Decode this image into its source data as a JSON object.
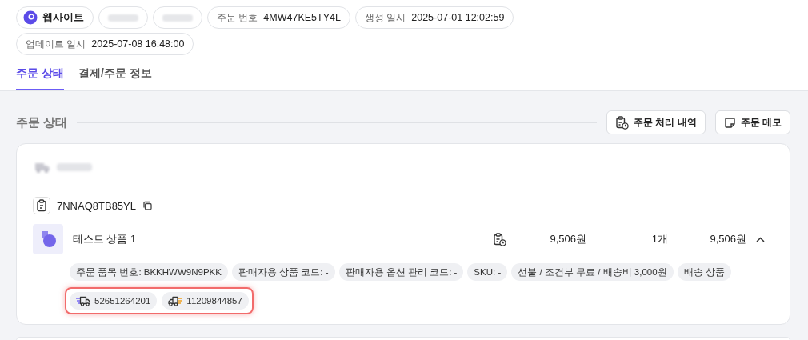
{
  "header_chips": [
    {
      "kind": "source",
      "label": "웹사이트"
    },
    {
      "kind": "redacted"
    },
    {
      "kind": "redacted"
    },
    {
      "kind": "field",
      "label": "주문 번호",
      "value": "4MW47KE5TY4L"
    },
    {
      "kind": "field",
      "label": "생성 일시",
      "value": "2025-07-01 12:02:59"
    },
    {
      "kind": "field",
      "label": "업데이트 일시",
      "value": "2025-07-08 16:48:00"
    }
  ],
  "tabs": [
    {
      "label": "주문 상태",
      "selected": true
    },
    {
      "label": "결제/주문 정보",
      "selected": false
    }
  ],
  "section": {
    "title": "주문 상태",
    "buttons": [
      {
        "kind": "history",
        "label": "주문 처리 내역"
      },
      {
        "kind": "memo",
        "label": "주문 메모"
      }
    ]
  },
  "order_card": {
    "order_code": "7NNAQ8TB85YL",
    "items": [
      {
        "name": "테스트 상품 1",
        "unit_price": "9,506원",
        "quantity": "1개",
        "total": "9,506원",
        "expanded": true,
        "tags": [
          "주문 품목 번호: BKKHWW9N9PKK",
          "판매자용 상품 코드: -",
          "판매자용 옵션 관리 코드: -",
          "SKU: -",
          "선불 / 조건부 무료 / 배송비 3,000원",
          "배송 상품"
        ],
        "tracking_highlighted": true,
        "tracking": [
          {
            "kind": "delivery",
            "number": "52651264201"
          },
          {
            "kind": "return",
            "number": "11209844857"
          }
        ]
      }
    ]
  }
}
